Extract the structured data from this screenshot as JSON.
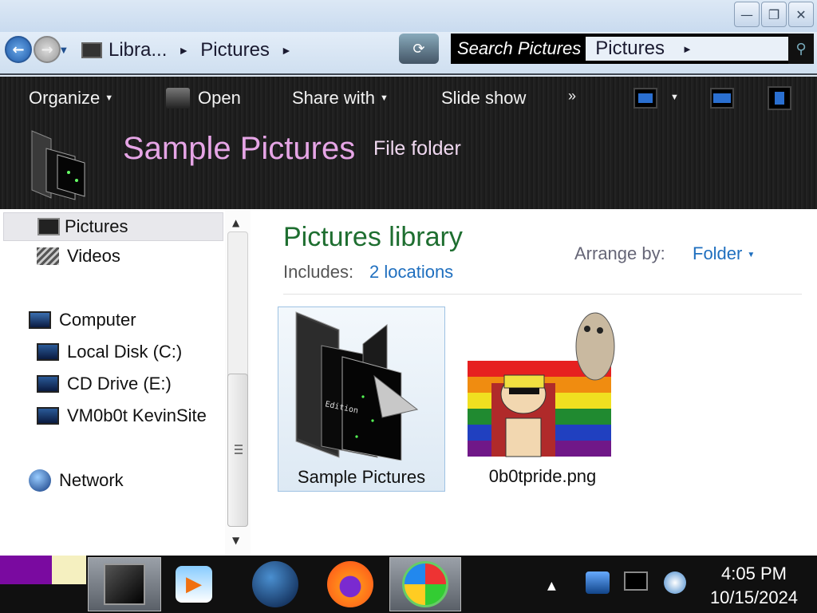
{
  "window": {
    "controls": {
      "minimize": "—",
      "maximize": "❐",
      "close": "✕"
    }
  },
  "address": {
    "crumbs": [
      "Libra...",
      "Pictures"
    ],
    "search_placeholder": "Search Pictures",
    "search_location": "Pictures"
  },
  "toolbar": {
    "organize": "Organize",
    "open": "Open",
    "share_with": "Share with",
    "slide_show": "Slide show",
    "more": "»"
  },
  "header": {
    "title": "Sample Pictures",
    "subtitle": "File folder"
  },
  "nav": {
    "items": [
      {
        "label": "Pictures",
        "icon": "pictures-icon"
      },
      {
        "label": "Videos",
        "icon": "videos-icon"
      },
      {
        "label": "Computer",
        "icon": "computer-icon"
      },
      {
        "label": "Local Disk (C:)",
        "icon": "disk-icon"
      },
      {
        "label": "CD Drive (E:)",
        "icon": "cd-drive-icon"
      },
      {
        "label": "VM0b0t KevinSite",
        "icon": "network-drive-icon"
      },
      {
        "label": "Network",
        "icon": "network-icon"
      }
    ]
  },
  "library": {
    "title": "Pictures library",
    "includes_label": "Includes:",
    "locations": "2 locations",
    "arrange_label": "Arrange by:",
    "arrange_value": "Folder"
  },
  "files": [
    {
      "name": "Sample Pictures",
      "type": "folder"
    },
    {
      "name": "0b0tpride.png",
      "type": "image"
    }
  ],
  "taskbar": {
    "time": "4:05 PM",
    "date": "10/15/2024",
    "tray_arrow": "▲"
  },
  "colors": {
    "header_title": "#e6a5e6",
    "library_title": "#1e6e30",
    "link": "#1f6fbf"
  }
}
